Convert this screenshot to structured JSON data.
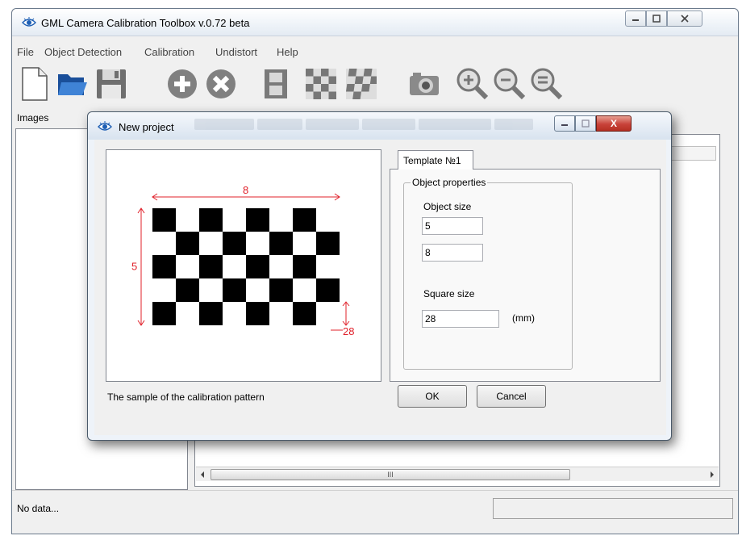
{
  "window": {
    "title": "GML Camera Calibration Toolbox  v.0.72 beta"
  },
  "menu": [
    "File",
    "Object Detection",
    "Calibration",
    "Undistort",
    "Help"
  ],
  "toolbar": {
    "icons": [
      "new-file-icon",
      "open-folder-icon",
      "save-icon",
      "add-icon",
      "remove-icon",
      "film-icon",
      "checkerboard-icon",
      "distorted-checkerboard-icon",
      "camera-icon",
      "zoom-in-icon",
      "zoom-out-icon",
      "zoom-fit-icon"
    ]
  },
  "images_label": "Images",
  "scroll_grip": "III",
  "status": {
    "text": "No data..."
  },
  "dialog": {
    "title": "New project",
    "close_glyph": "X",
    "caption": "The sample of the calibration pattern",
    "tab_label": "Template №1",
    "group_label": "Object properties",
    "object_size_label": "Object size",
    "object_size_rows": "5",
    "object_size_cols": "8",
    "square_size_label": "Square size",
    "square_size_value": "28",
    "square_unit": "(mm)",
    "ok_label": "OK",
    "cancel_label": "Cancel"
  },
  "pattern": {
    "rows": 5,
    "cols": 8,
    "cols_label": "8",
    "rows_label": "5",
    "square_label": "28",
    "square_color": "#000000",
    "dimension_color": "#e0202a"
  },
  "colors": {
    "accent": "#1e5fb4",
    "close_red": "#c8423a"
  }
}
